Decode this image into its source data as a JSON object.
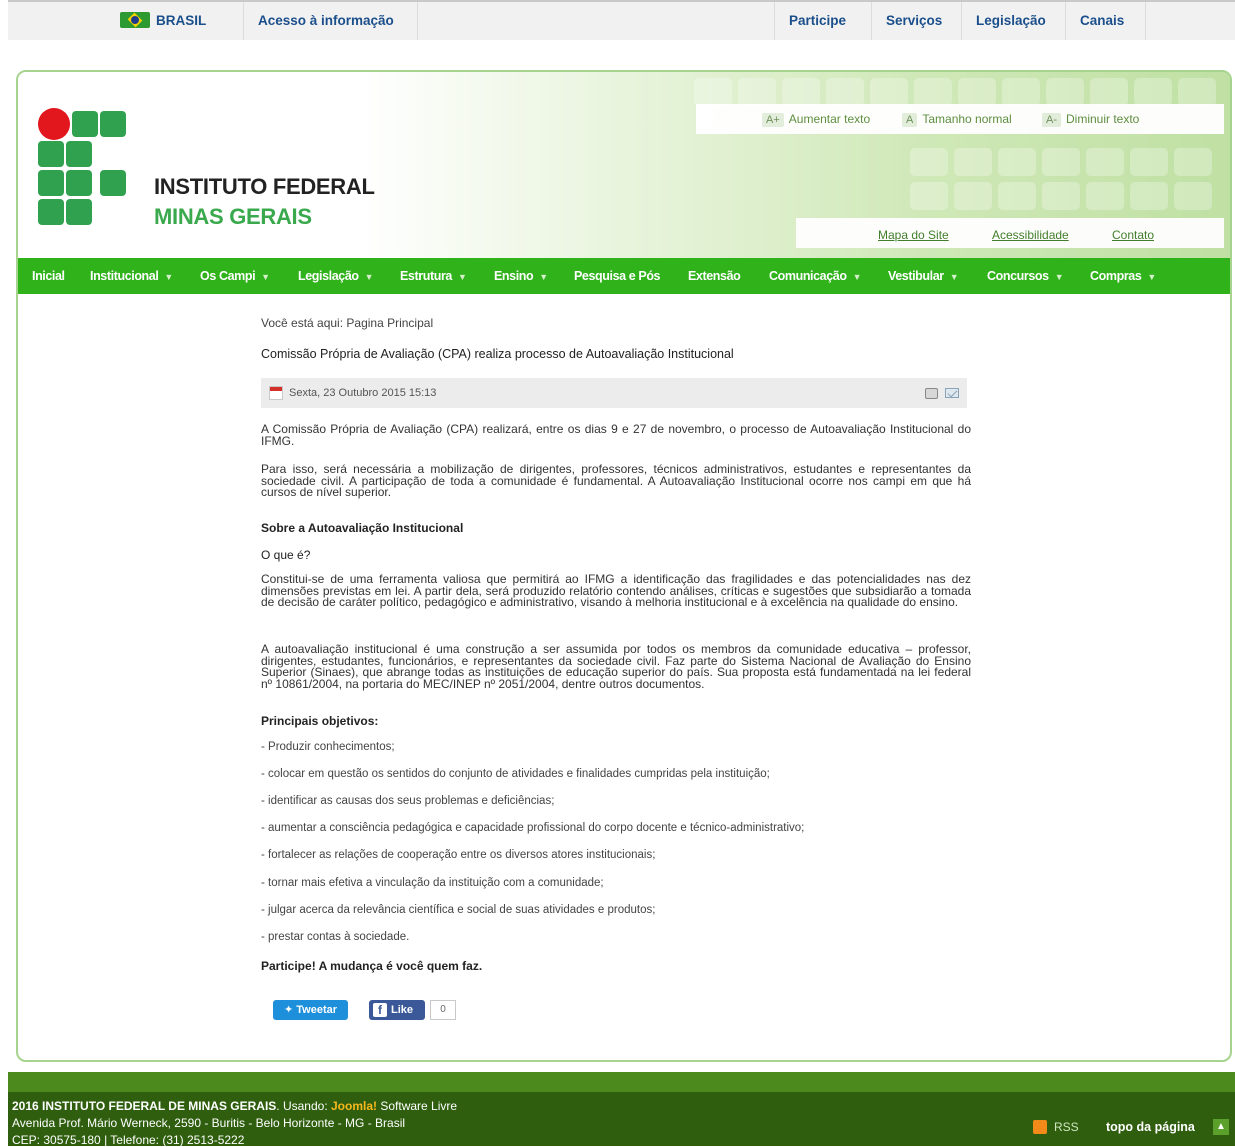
{
  "gov_bar": {
    "country": "BRASIL",
    "access_info": "Acesso à informação",
    "links": [
      "Participe",
      "Serviços",
      "Legislação",
      "Canais"
    ]
  },
  "header": {
    "institute_name": "INSTITUTO FEDERAL",
    "institute_sub": "MINAS GERAIS",
    "font_controls": [
      {
        "badge": "A+",
        "label": "Aumentar texto"
      },
      {
        "badge": "A",
        "label": "Tamanho normal"
      },
      {
        "badge": "A-",
        "label": "Diminuir texto"
      }
    ],
    "site_links": [
      "Mapa do Site",
      "Acessibilidade",
      "Contato"
    ],
    "brand_colors": {
      "green": "#30a14e",
      "red": "#e2171d",
      "nav": "#2fb21a"
    }
  },
  "nav": [
    {
      "label": "Inicial",
      "dropdown": false
    },
    {
      "label": "Institucional",
      "dropdown": true
    },
    {
      "label": "Os Campi",
      "dropdown": true
    },
    {
      "label": "Legislação",
      "dropdown": true
    },
    {
      "label": "Estrutura",
      "dropdown": true
    },
    {
      "label": "Ensino",
      "dropdown": true
    },
    {
      "label": "Pesquisa e Pós",
      "dropdown": false
    },
    {
      "label": "Extensão",
      "dropdown": false
    },
    {
      "label": "Comunicação",
      "dropdown": true
    },
    {
      "label": "Vestibular",
      "dropdown": true
    },
    {
      "label": "Concursos",
      "dropdown": true
    },
    {
      "label": "Compras",
      "dropdown": true
    }
  ],
  "content": {
    "breadcrumb": "Você está aqui: Pagina Principal",
    "title": "Comissão Própria de Avaliação (CPA) realiza processo de Autoavaliação Institucional",
    "date": "Sexta, 23 Outubro 2015 15:13",
    "intro": "A Comissão Própria de Avaliação (CPA) realizará, entre os dias 9 e 27 de novembro, o processo de Autoavaliação Institucional do IFMG.",
    "para1": "Para isso, será necessária a mobilização de dirigentes, professores, técnicos administrativos, estudantes e representantes da sociedade civil. A participação de toda a comunidade é fundamental. A Autoavaliação Institucional ocorre nos campi em que há cursos de nível superior.",
    "about_heading": "Sobre a Autoavaliação Institucional",
    "what_heading": "O que é?",
    "para2": "Constitui-se de uma ferramenta valiosa que permitirá ao IFMG a identificação das fragilidades e das potencialidades nas dez dimensões previstas em lei. A partir dela, será produzido relatório contendo análises, críticas e sugestões que subsidiarão a tomada de decisão de caráter político, pedagógico e administrativo, visando à melhoria institucional e à excelência na qualidade do ensino.",
    "para3": "A autoavaliação institucional é uma construção a ser assumida por todos os membros da comunidade educativa – professor, dirigentes, estudantes, funcionários, e representantes da sociedade civil. Faz parte do Sistema Nacional de Avaliação do Ensino Superior (Sinaes), que abrange todas as instituições de educação superior do país. Sua proposta está fundamentada na lei federal nº 10861/2004, na portaria do MEC/INEP nº 2051/2004, dentre outros documentos.",
    "objectives_heading": "Principais objetivos:",
    "objectives": [
      "- Produzir conhecimentos;",
      "- colocar em questão os sentidos do conjunto de atividades e finalidades cumpridas pela instituição;",
      "- identificar as causas dos seus problemas e deficiências;",
      "- aumentar a consciência pedagógica e capacidade profissional do corpo docente e técnico-administrativo;",
      "- fortalecer as relações de cooperação entre os diversos atores institucionais;",
      "- tornar mais efetiva a vinculação da instituição com a comunidade;",
      "- julgar acerca da relevância científica e social de suas atividades e produtos;",
      "- prestar contas à sociedade."
    ],
    "closing": "Participe! A mudança é você quem faz.",
    "tweet_label": "Tweetar",
    "like_label": "Like",
    "like_count": "0"
  },
  "footer": {
    "year": "2016",
    "org": "INSTITUTO FEDERAL DE MINAS GERAIS",
    "using": ". Usando: ",
    "joomla": "Joomla!",
    "software": " Software Livre",
    "address": "Avenida Prof. Mário Werneck, 2590 - Buritis - Belo Horizonte - MG - Brasil",
    "cep": "CEP: 30575-180 | Telefone: (31) 2513-5222",
    "rss": "RSS",
    "top": "topo da página"
  }
}
